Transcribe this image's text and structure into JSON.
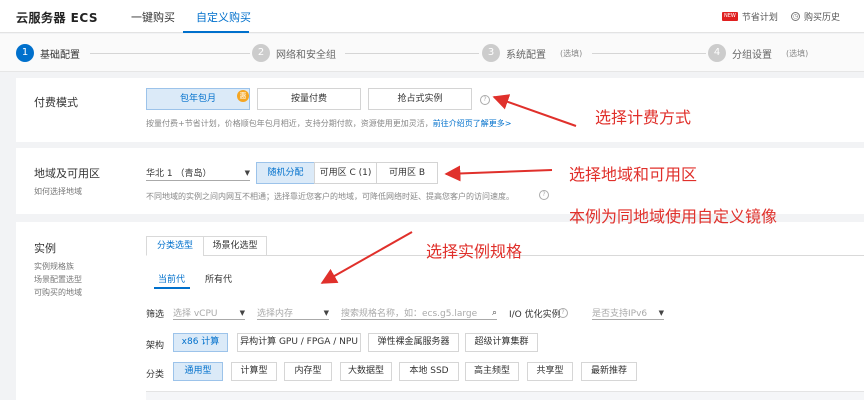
{
  "app": {
    "title": "云服务器 ECS"
  },
  "top_tabs": [
    {
      "label": "一键购买"
    },
    {
      "label": "自定义购买"
    }
  ],
  "top_right": {
    "badge": "NEW",
    "plan_label": "节省计划",
    "history_label": "购买历史"
  },
  "steps": [
    {
      "num": "1",
      "label": "基础配置",
      "optional": ""
    },
    {
      "num": "2",
      "label": "网络和安全组",
      "optional": ""
    },
    {
      "num": "3",
      "label": "系统配置",
      "optional": "(选填)"
    },
    {
      "num": "4",
      "label": "分组设置",
      "optional": "(选填)"
    }
  ],
  "billing": {
    "title": "付费模式",
    "options": [
      "包年包月",
      "按量付费",
      "抢占式实例"
    ],
    "selected": "包年包月",
    "discount_badge": "惠",
    "hint": "按量付费+节省计划，价格顺包年包月相近，支持分期付款，资源使用更加灵活，",
    "hint_link": "前往介绍页了解更多>"
  },
  "region": {
    "title": "地域及可用区",
    "sub": "如何选择地域",
    "select_value": "华北 1 （青岛）",
    "zones": [
      "随机分配",
      "可用区 C (1)",
      "可用区 B"
    ],
    "selected_zone": "随机分配",
    "hint": "不同地域的实例之间内网互不相通；选择靠近您客户的地域，可降低网络时延、提高您客户的访问速度。"
  },
  "instance": {
    "title": "实例",
    "side_links": [
      "实例规格族",
      "场景配置选型",
      "可购买的地域"
    ],
    "tabs": [
      "分类选型",
      "场景化选型"
    ],
    "subtabs": [
      "当前代",
      "所有代"
    ],
    "filter": {
      "label": "筛选",
      "vcpu_placeholder": "选择 vCPU",
      "mem_placeholder": "选择内存",
      "search_placeholder": "搜索规格名称，如：ecs.g5.large",
      "io_label": "I/O 优化实例",
      "ipv6_placeholder": "是否支持IPv6"
    },
    "arch": {
      "label": "架构",
      "options": [
        "x86 计算",
        "异构计算 GPU / FPGA / NPU",
        "弹性裸金属服务器",
        "超级计算集群"
      ],
      "selected": "x86 计算"
    },
    "category": {
      "label": "分类",
      "options": [
        "通用型",
        "计算型",
        "内存型",
        "大数据型",
        "本地 SSD",
        "高主频型",
        "共享型",
        "最新推荐"
      ],
      "selected": "通用型"
    }
  },
  "annotations": {
    "billing": "选择计费方式",
    "region": "选择地域和可用区",
    "image": "本例为同地域使用自定义镜像",
    "instance": "选择实例规格"
  },
  "colors": {
    "accent": "#0070cc",
    "annotation": "#e0302b",
    "selected_bg": "#dbeaf8"
  }
}
